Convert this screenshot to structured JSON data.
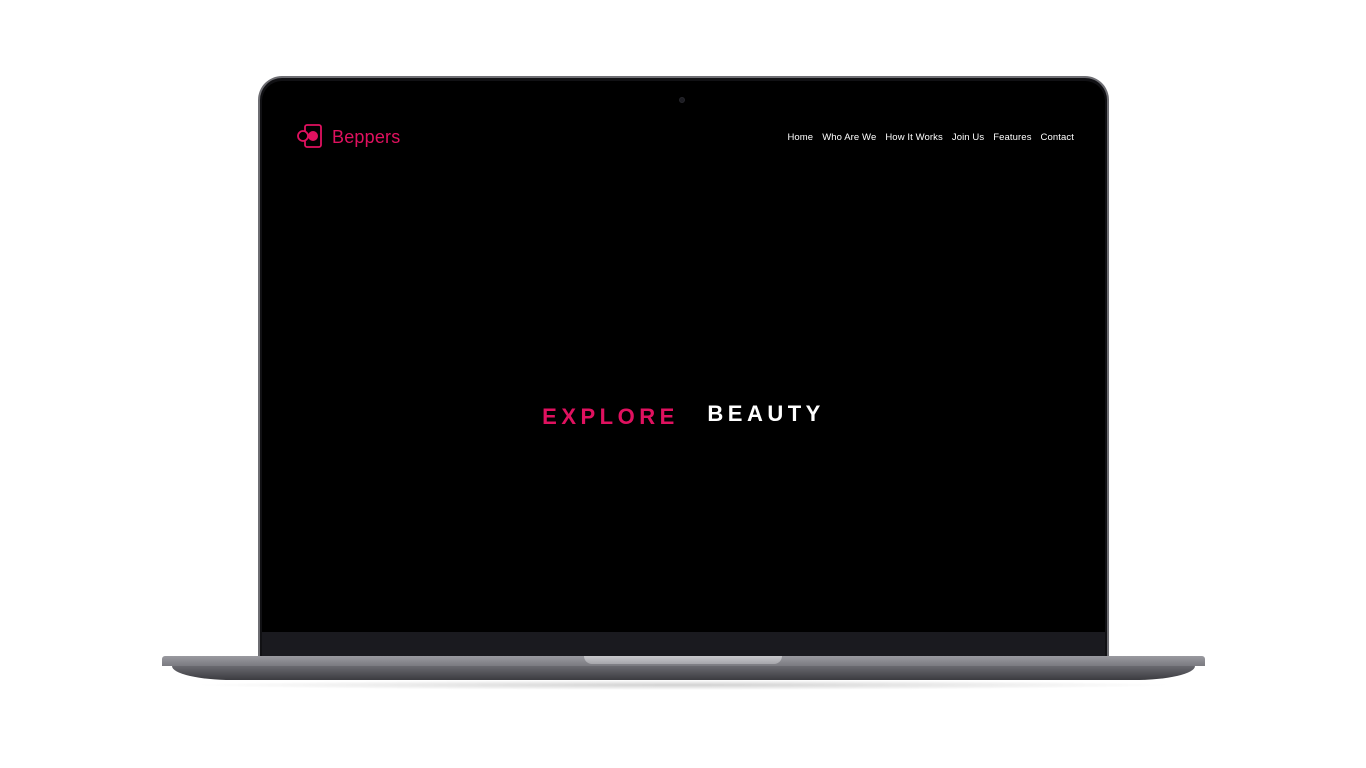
{
  "site": {
    "brand": "Beppers",
    "brand_icon": "beppers-logo-icon",
    "accent_color": "#e0115f"
  },
  "nav": {
    "items": [
      {
        "label": "Home"
      },
      {
        "label": "Who Are We"
      },
      {
        "label": "How It Works"
      },
      {
        "label": "Join Us"
      },
      {
        "label": "Features"
      },
      {
        "label": "Contact"
      }
    ]
  },
  "hero": {
    "accent": "EXPLORE",
    "main": "BEAUTY"
  }
}
